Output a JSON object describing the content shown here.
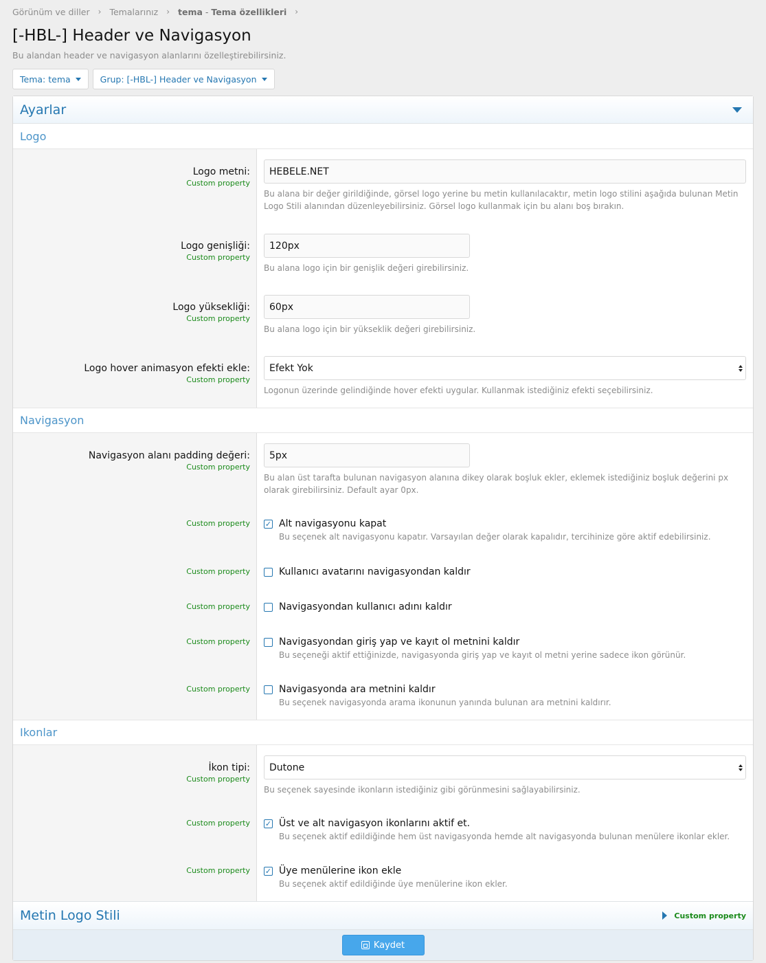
{
  "breadcrumb": {
    "items": [
      "Görünüm ve diller",
      "Temalarınız"
    ],
    "current_strong": "tema",
    "current_rest": "Tema özellikleri",
    "current_sep": " - "
  },
  "page": {
    "title": "[-HBL-] Header ve Navigasyon",
    "description": "Bu alandan header ve navigasyon alanlarını özelleştirebilirsiniz."
  },
  "filters": {
    "theme": "Tema: tema",
    "group": "Grup: [-HBL-] Header ve Navigasyon"
  },
  "block": {
    "title": "Ayarlar"
  },
  "custom_label": "Custom property",
  "logo": {
    "section": "Logo",
    "text_label": "Logo metni:",
    "text_value": "HEBELE.NET",
    "text_hint": "Bu alana bir değer girildiğinde, görsel logo yerine bu metin kullanılacaktır, metin logo stilini aşağıda bulunan Metin Logo Stili alanından düzenleyebilirsiniz. Görsel logo kullanmak için bu alanı boş bırakın.",
    "width_label": "Logo genişliği:",
    "width_value": "120px",
    "width_hint": "Bu alana logo için bir genişlik değeri girebilirsiniz.",
    "height_label": "Logo yüksekliği:",
    "height_value": "60px",
    "height_hint": "Bu alana logo için bir yükseklik değeri girebilirsiniz.",
    "hover_label": "Logo hover animasyon efekti ekle:",
    "hover_value": "Efekt Yok",
    "hover_hint": "Logonun üzerinde gelindiğinde hover efekti uygular. Kullanmak istediğiniz efekti seçebilirsiniz."
  },
  "nav": {
    "section": "Navigasyon",
    "padding_label": "Navigasyon alanı padding değeri:",
    "padding_value": "5px",
    "padding_hint": "Bu alan üst tarafta bulunan navigasyon alanına dikey olarak boşluk ekler, eklemek istediğiniz boşluk değerini px olarak girebilirsiniz. Default ayar 0px.",
    "opt1_label": "Alt navigasyonu kapat",
    "opt1_hint": "Bu seçenek alt navigasyonu kapatır. Varsayılan değer olarak kapalıdır, tercihinize göre aktif edebilirsiniz.",
    "opt2_label": "Kullanıcı avatarını navigasyondan kaldır",
    "opt3_label": "Navigasyondan kullanıcı adını kaldır",
    "opt4_label": "Navigasyondan giriş yap ve kayıt ol metnini kaldır",
    "opt4_hint": "Bu seçeneği aktif ettiğinizde, navigasyonda giriş yap ve kayıt ol metni yerine sadece ikon görünür.",
    "opt5_label": "Navigasyonda ara metnini kaldır",
    "opt5_hint": "Bu seçenek navigasyonda arama ikonunun yanında bulunan ara metnini kaldırır."
  },
  "icons": {
    "section": "Ikonlar",
    "type_label": "İkon tipi:",
    "type_value": "Dutone",
    "type_hint": "Bu seçenek sayesinde ikonların istediğiniz gibi görünmesini sağlayabilirsiniz.",
    "opt1_label": "Üst ve alt navigasyon ikonlarını aktif et.",
    "opt1_hint": "Bu seçenek aktif edildiğinde hem üst navigasyonda hemde alt navigasyonda bulunan menülere ikonlar ekler.",
    "opt2_label": "Üye menülerine ikon ekle",
    "opt2_hint": "Bu seçenek aktif edildiğinde üye menülerine ikon ekler."
  },
  "metin": {
    "title": "Metin Logo Stili"
  },
  "footer": {
    "save": "Kaydet"
  },
  "colors": {
    "accent": "#2577b1",
    "section": "#4d95c9",
    "custom": "#1a8a1a",
    "save": "#47a7eb"
  }
}
